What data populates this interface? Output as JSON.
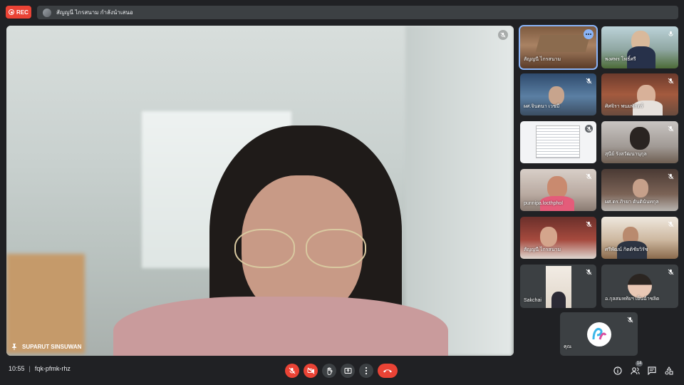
{
  "recording": {
    "label": "REC"
  },
  "presentation": {
    "text": "สัญญนี ไกรสนาม กำลังนำเสนอ"
  },
  "main_video": {
    "participant": "SUPARUT SINSUWAN"
  },
  "tiles": [
    {
      "name": "สัญญนี ไกรสนาม",
      "muted": false,
      "selected": true
    },
    {
      "name": "พงศพร โพธิ์ศรี",
      "muted": false
    },
    {
      "name": "ผศ.จินตนา เวชมี",
      "muted": true
    },
    {
      "name": "ศิศจิรา พนมพักตร์",
      "muted": true
    },
    {
      "name": "",
      "muted": true
    },
    {
      "name": "สุนีย์ รังสวัฒนานุกุล",
      "muted": true
    },
    {
      "name": "punnipa.locthphol",
      "muted": true
    },
    {
      "name": "ผศ.ดร.ภิรยา ตันตินันทกุล",
      "muted": true
    },
    {
      "name": "สัญญนี ไกรสนาม",
      "muted": true
    },
    {
      "name": "ศรีพัฒน์ กิตติชัยวิรัช",
      "muted": true
    },
    {
      "name": "Sakchai",
      "muted": true
    },
    {
      "name": "อ.กุลสมหทัยฯ เย็นฉำชลิต",
      "muted": true
    },
    {
      "name": "คุณ",
      "muted": true
    }
  ],
  "meeting": {
    "time": "10:55",
    "code": "fqk-pfmk-rhz"
  },
  "participants_count": "14",
  "colors": {
    "red": "#ea4335",
    "accent": "#8ab4f8",
    "bar": "#3c4043",
    "bg": "#202124"
  }
}
